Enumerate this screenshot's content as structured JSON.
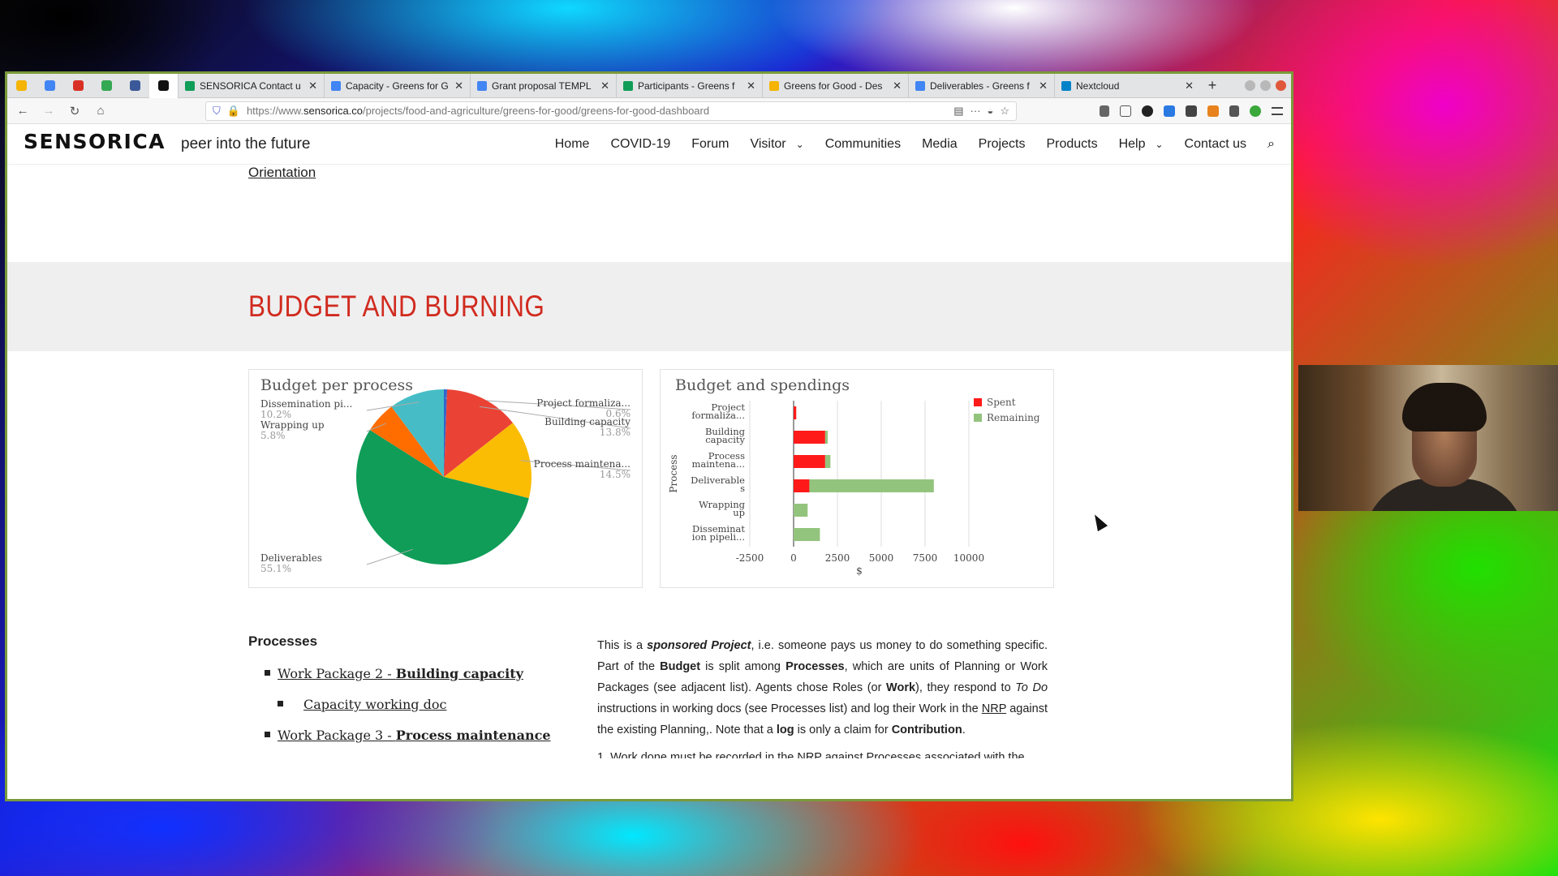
{
  "browser": {
    "pinned_tabs": [
      {
        "icon": "drive-icon",
        "color": "#f4b400"
      },
      {
        "icon": "calendar-icon",
        "color": "#4285f4"
      },
      {
        "icon": "gmail-icon",
        "color": "#d93025"
      },
      {
        "icon": "drive-icon",
        "color": "#34a853"
      },
      {
        "icon": "forms-icon",
        "color": "#3b5998"
      },
      {
        "icon": "sensorica-icon",
        "color": "#111111"
      }
    ],
    "tabs": [
      {
        "title": "SENSORICA Contact u",
        "icon": "sheets-icon",
        "color": "#0f9d58"
      },
      {
        "title": "Capacity - Greens for G",
        "icon": "docs-icon",
        "color": "#4285f4"
      },
      {
        "title": "Grant proposal TEMPL",
        "icon": "docs-icon",
        "color": "#4285f4"
      },
      {
        "title": "Participants - Greens f",
        "icon": "sheets-icon",
        "color": "#0f9d58"
      },
      {
        "title": "Greens for Good - Des",
        "icon": "slides-icon",
        "color": "#f4b400"
      },
      {
        "title": "Deliverables - Greens f",
        "icon": "docs-icon",
        "color": "#4285f4"
      },
      {
        "title": "Nextcloud",
        "icon": "nextcloud-icon",
        "color": "#0082c9"
      }
    ],
    "url_prefix": "https://www.",
    "url_domain": "sensorica.co",
    "url_path": "/projects/food-and-agriculture/greens-for-good/greens-for-good-dashboard"
  },
  "site": {
    "logo": "SENSORICA",
    "tagline": "peer into the future",
    "menu": [
      "Home",
      "COVID-19",
      "Forum",
      "Visitor",
      "Communities",
      "Media",
      "Projects",
      "Products",
      "Help",
      "Contact us"
    ]
  },
  "page": {
    "orientation_link": "Orientation",
    "section_title": "BUDGET AND BURNING",
    "processes_heading": "Processes",
    "process_items": [
      {
        "prefix": "Work Package 2 - ",
        "bold": "Building capacity",
        "level": 1
      },
      {
        "text": "Capacity working doc",
        "level": 2
      },
      {
        "prefix": "Work Package 3 - ",
        "bold": "Process maintenance",
        "level": 1
      }
    ],
    "para": {
      "p1": "This is a ",
      "p2": "sponsored Project",
      "p3": ", i.e. someone pays us money to do something specific. Part of the ",
      "p4": "Budget",
      "p5": " is split among ",
      "p6": "Processes",
      "p7": ", which are units of Planning or Work Packages (see adjacent list). Agents chose Roles (or ",
      "p8": "Work",
      "p9": "), they respond to ",
      "p10": "To Do",
      "p11": " instructions in working docs (see Processes list) and log their Work in the ",
      "p12": "NRP",
      "p13": " against the existing Planning,. Note that a ",
      "p14": "log",
      "p15": " is only a claim for ",
      "p16": "Contribution",
      "p17": ".",
      "p18": "1. Work done must be recorded in the NRP against Processes associated with the"
    }
  },
  "chart_data": [
    {
      "type": "pie",
      "title": "Budget per process",
      "slices": [
        {
          "label": "Project formaliza...",
          "percent": "0.6%",
          "value": 0.6,
          "color": "#3366cc"
        },
        {
          "label": "Building capacity",
          "percent": "13.8%",
          "value": 13.8,
          "color": "#ea4335"
        },
        {
          "label": "Process maintena...",
          "percent": "14.5%",
          "value": 14.5,
          "color": "#fbbc04"
        },
        {
          "label": "Deliverables",
          "percent": "55.1%",
          "value": 55.1,
          "color": "#0f9d58"
        },
        {
          "label": "Wrapping up",
          "percent": "5.8%",
          "value": 5.8,
          "color": "#ff6d01"
        },
        {
          "label": "Dissemination pi...",
          "percent": "10.2%",
          "value": 10.2,
          "color": "#46bdc6"
        }
      ]
    },
    {
      "type": "bar",
      "orientation": "horizontal",
      "stacked": true,
      "title": "Budget and spendings",
      "ylabel": "Process",
      "xlabel": "$",
      "xlim": [
        -2500,
        10000
      ],
      "xticks": [
        "-2500",
        "0",
        "2500",
        "5000",
        "7500",
        "10000"
      ],
      "categories": [
        [
          "Project",
          "formaliza..."
        ],
        [
          "Building",
          "capacity"
        ],
        [
          "Process",
          "maintena..."
        ],
        [
          "Deliverable",
          "s"
        ],
        [
          "Wrapping",
          "up"
        ],
        [
          "Disseminat",
          "ion pipeli..."
        ]
      ],
      "series": [
        {
          "name": "Spent",
          "color": "#ff1a1a",
          "values": [
            150,
            1800,
            1800,
            900,
            0,
            0
          ]
        },
        {
          "name": "Remaining",
          "color": "#93c47d",
          "values": [
            0,
            150,
            300,
            7100,
            800,
            1500
          ]
        }
      ],
      "legend": "right"
    }
  ]
}
